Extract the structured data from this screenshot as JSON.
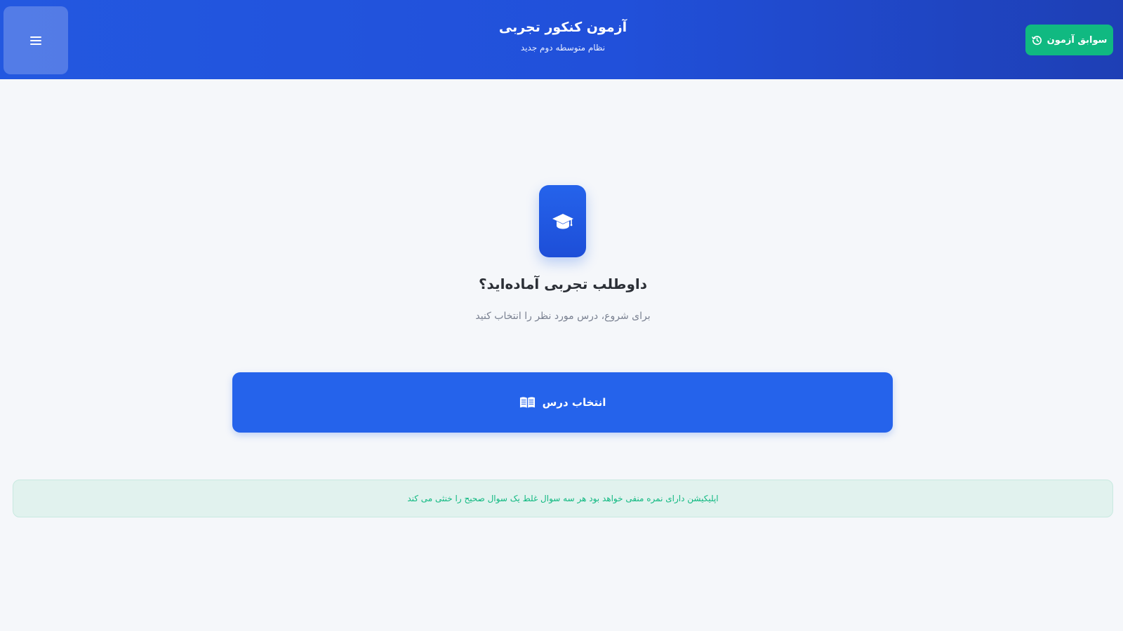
{
  "header": {
    "title": "آزمون کنکور تجربی",
    "subtitle": "نظام متوسطه دوم جدید",
    "menu_icon": "hamburger-menu-icon",
    "history_button": {
      "label": "سوابق آزمون",
      "icon": "history-clock-icon"
    }
  },
  "main": {
    "hero_icon": "graduation-cap-icon",
    "title": "داوطلب تجربی آماده‌اید؟",
    "subtitle": "برای شروع، درس مورد نظر را انتخاب کنید",
    "select_button": {
      "label": "انتخاب درس",
      "icon": "open-book-icon"
    }
  },
  "notice": {
    "text": "اپلیکیشن دارای نمره منفی خواهد بود هر سه سوال غلط یک سوال صحیح را خنثی می کند"
  },
  "colors": {
    "header_blue": "#2358e0",
    "primary_blue": "#2563eb",
    "success_green": "#10b981",
    "notice_bg": "#e1f2ee",
    "page_bg": "#f5f7fa"
  }
}
